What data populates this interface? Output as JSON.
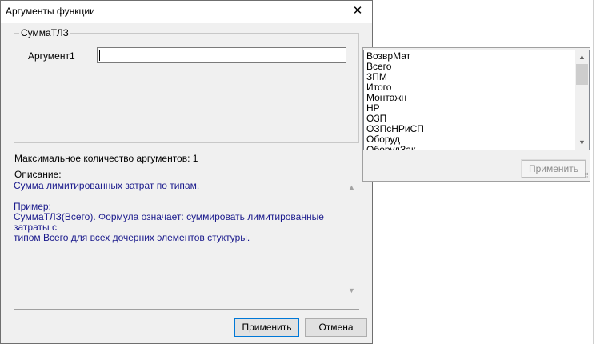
{
  "dialog": {
    "title": "Аргументы функции",
    "group_title": "СуммаТЛЗ",
    "argument_label": "Аргумент1",
    "argument_value": "",
    "max_args": "Максимальное количество аргументов: 1",
    "description_label": "Описание:",
    "description_lines": [
      "Сумма лимитированных затрат по типам.",
      "",
      "Пример:",
      "СуммаТЛЗ(Всего). Формула означает: суммировать лимитированные затраты с",
      "типом Всего для всех дочерних элементов стуктуры."
    ],
    "apply_label": "Применить",
    "cancel_label": "Отмена"
  },
  "popup": {
    "items": [
      "ВозврМат",
      "Всего",
      "ЗПМ",
      "Итого",
      "Монтажн",
      "НР",
      "ОЗП",
      "ОЗПсНРиСП",
      "Оборуд",
      "ОборудЗак"
    ],
    "apply_label": "Применить"
  },
  "colors": {
    "dialog_bg": "#f0f0f0",
    "description_text": "#1a1a8c",
    "disabled_text": "#8d8d8d"
  }
}
